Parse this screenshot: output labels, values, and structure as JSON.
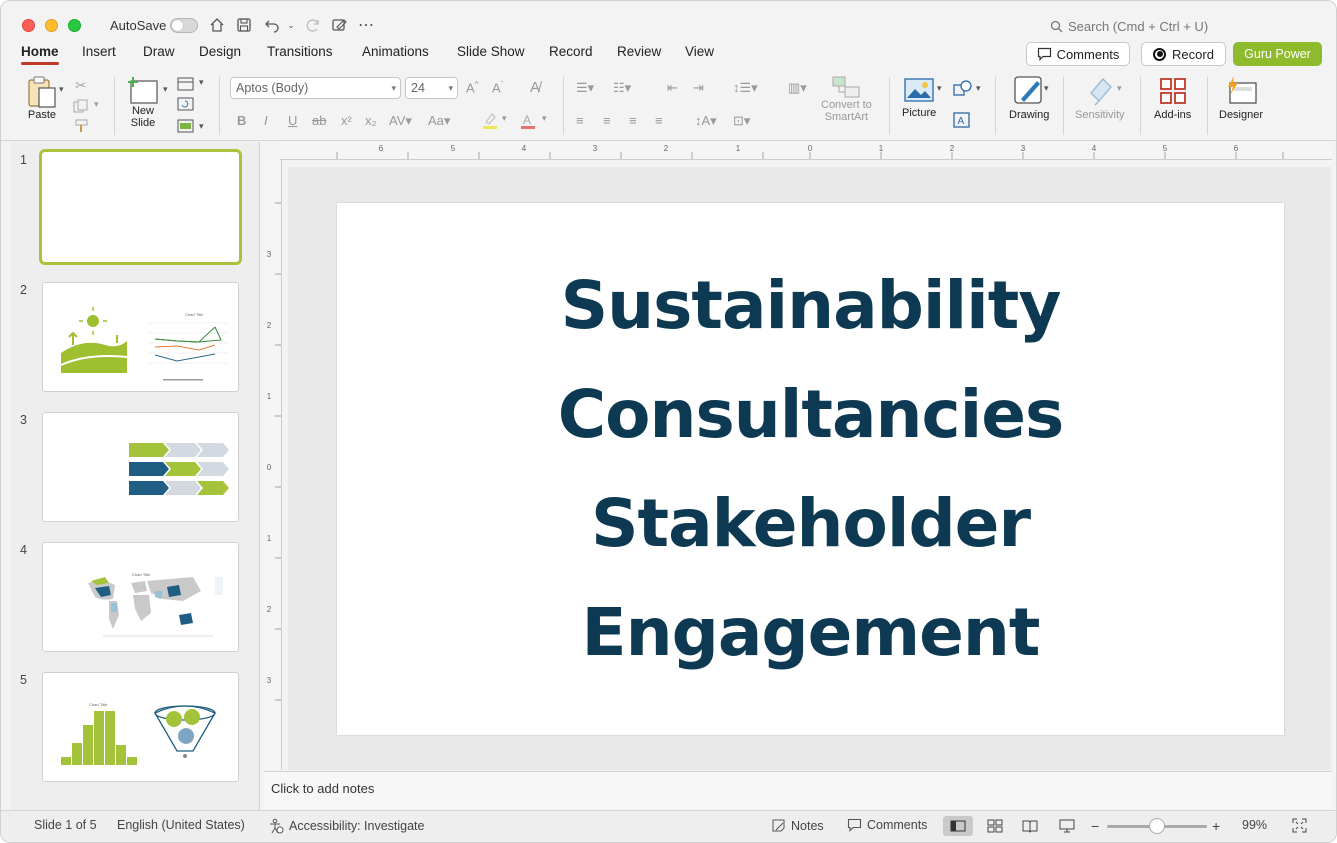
{
  "titlebar": {
    "autosave_label": "AutoSave",
    "search_placeholder": "Search (Cmd + Ctrl + U)"
  },
  "tabs": [
    "Home",
    "Insert",
    "Draw",
    "Design",
    "Transitions",
    "Animations",
    "Slide Show",
    "Record",
    "Review",
    "View"
  ],
  "header_buttons": {
    "comments": "Comments",
    "record": "Record",
    "guru": "Guru Power"
  },
  "ribbon": {
    "paste": "Paste",
    "new_slide": "New\nSlide",
    "font_name": "Aptos (Body)",
    "font_size": "24",
    "convert_smartart": "Convert to\nSmartArt",
    "picture": "Picture",
    "drawing": "Drawing",
    "sensitivity": "Sensitivity",
    "addins": "Add-ins",
    "designer": "Designer"
  },
  "thumbnails": [
    "1",
    "2",
    "3",
    "4",
    "5"
  ],
  "thumb_chart_title": "Chart Title",
  "ruler_h": [
    "6",
    "5",
    "4",
    "3",
    "2",
    "1",
    "0",
    "1",
    "2",
    "3",
    "4",
    "5",
    "6"
  ],
  "ruler_v": [
    "3",
    "2",
    "1",
    "0",
    "1",
    "2",
    "3"
  ],
  "slide": {
    "lines": [
      "Sustainability",
      "Consultancies",
      "Stakeholder",
      "Engagement"
    ]
  },
  "notes_placeholder": "Click to add notes",
  "status": {
    "slide_info": "Slide 1 of 5",
    "language": "English (United States)",
    "accessibility": "Accessibility: Investigate",
    "notes": "Notes",
    "comments": "Comments",
    "zoom": "99%"
  },
  "colors": {
    "accent_green": "#8dbb2b",
    "slide_text": "#0d3a52",
    "tab_underline": "#c0392b"
  }
}
